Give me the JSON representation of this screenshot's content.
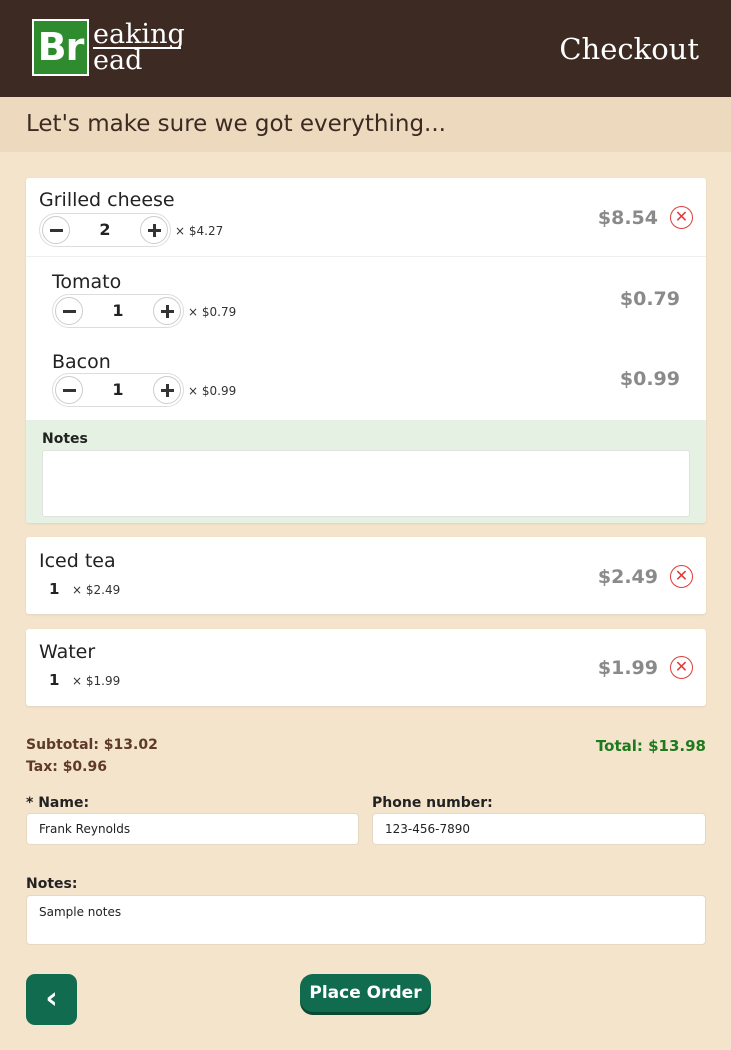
{
  "header": {
    "logo_symbol": "Br",
    "logo_line1": "eaking",
    "logo_line2": "ead",
    "title": "Checkout"
  },
  "subheading": "Let's make sure we got everything...",
  "order": {
    "items": [
      {
        "name": "Grilled cheese",
        "quantity": "2",
        "unit_price": "× $4.27",
        "price": "$8.54",
        "addons": [
          {
            "name": "Tomato",
            "quantity": "1",
            "unit_price": "× $0.79",
            "price": "$0.79"
          },
          {
            "name": "Bacon",
            "quantity": "1",
            "unit_price": "× $0.99",
            "price": "$0.99"
          }
        ],
        "notes_label": "Notes",
        "notes_value": ""
      },
      {
        "name": "Iced tea",
        "quantity": "1",
        "unit_price": "× $2.49",
        "price": "$2.49"
      },
      {
        "name": "Water",
        "quantity": "1",
        "unit_price": "× $1.99",
        "price": "$1.99"
      }
    ]
  },
  "summary": {
    "subtotal": "Subtotal: $13.02",
    "tax": "Tax: $0.96",
    "total": "Total: $13.98"
  },
  "form": {
    "name_label": "* Name:",
    "name_value": "Frank Reynolds",
    "phone_label": "Phone number:",
    "phone_value": "123-456-7890",
    "notes_label": "Notes:",
    "notes_value": "Sample notes"
  },
  "actions": {
    "back_icon": "‹",
    "place_order": "Place Order"
  },
  "colors": {
    "header_bg": "#3c2a23",
    "page_bg": "#f4e4cc",
    "accent_green": "#116b4e",
    "total_green": "#1f7a1f",
    "remove_red": "#e03b3b"
  },
  "icons": {
    "remove": "close-circle-icon",
    "minus": "minus-icon",
    "plus": "plus-icon",
    "back": "chevron-left-icon"
  }
}
